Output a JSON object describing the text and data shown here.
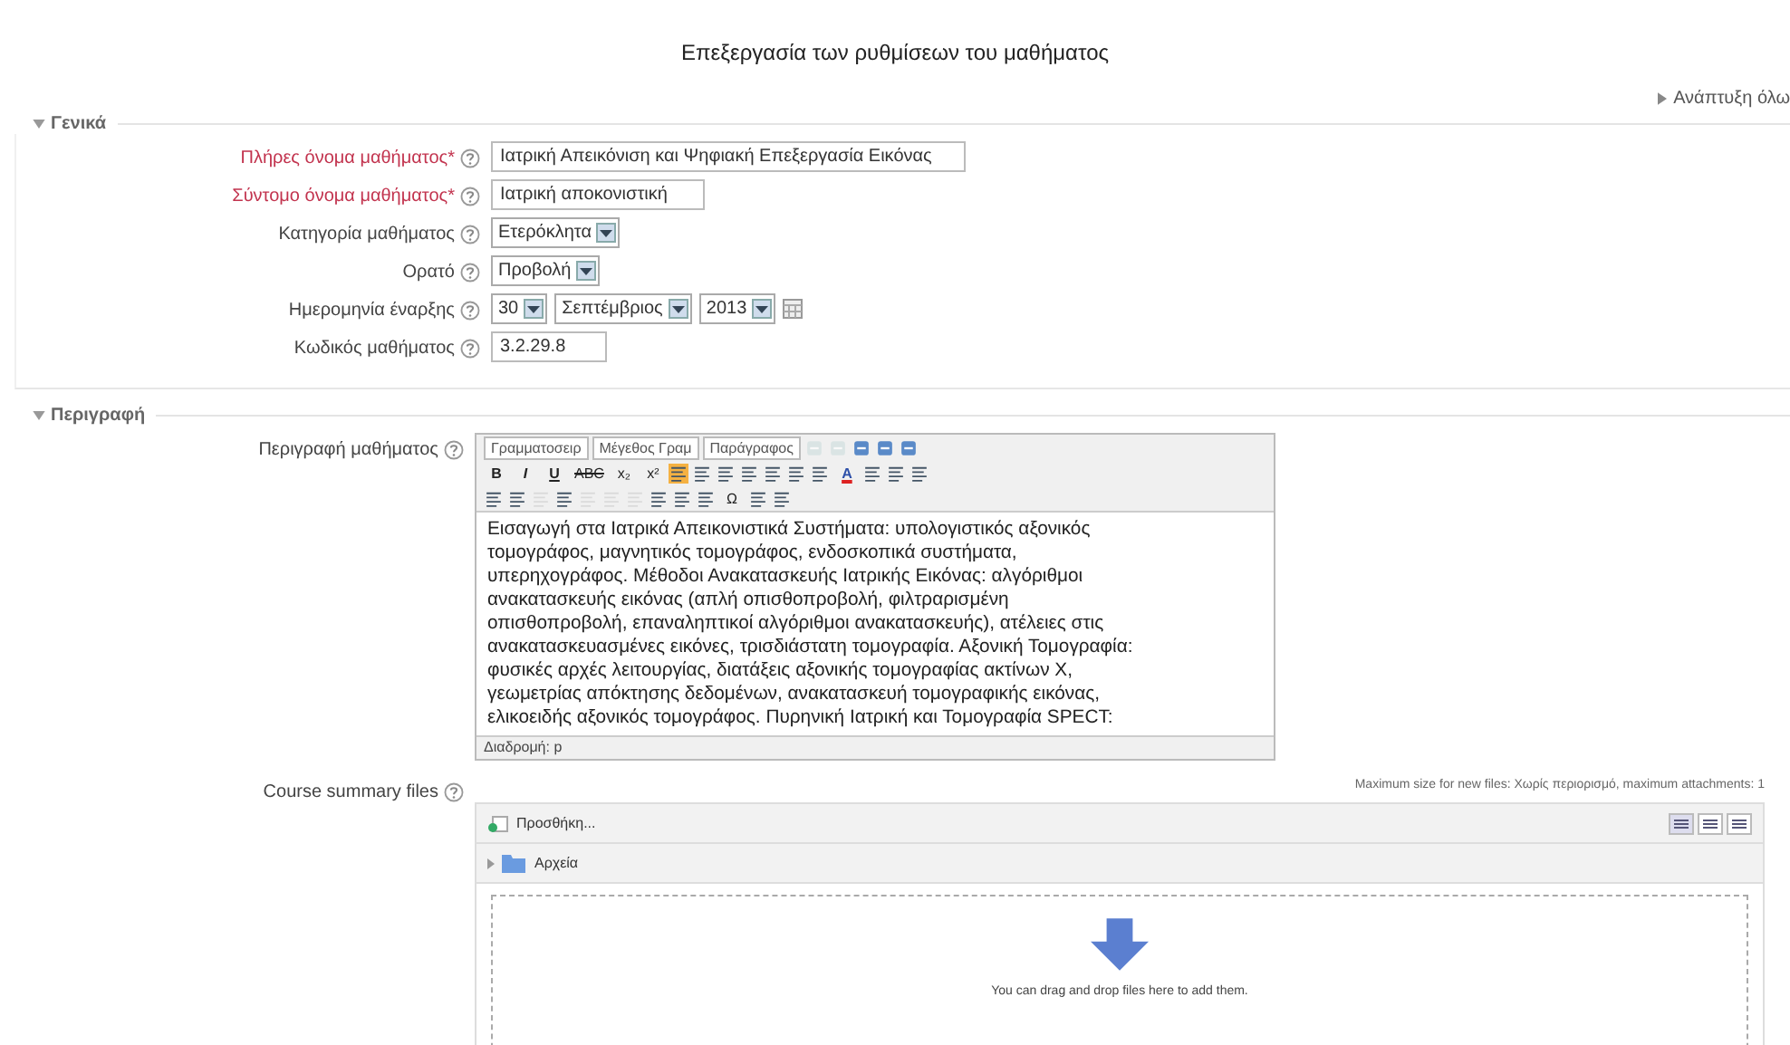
{
  "page_title": "Επεξεργασία των ρυθμίσεων του μαθήματος",
  "expand_all": {
    "label": "Ανάπτυξη όλω"
  },
  "sections": [
    {
      "legend": "Γενικά",
      "expanded": true,
      "fields": [
        {
          "label": "Πλήρες όνομα μαθήματος*",
          "required": true,
          "kind": "text",
          "value": "Ιατρική Απεικόνιση και Ψηφιακή Επεξεργασία Εικόνας"
        },
        {
          "label": "Σύντομο όνομα μαθήματος*",
          "required": true,
          "kind": "text",
          "value": "Ιατρική αποκονιστική"
        },
        {
          "label": "Κατηγορία μαθήματος",
          "required": false,
          "kind": "select",
          "value": "Ετερόκλητα"
        },
        {
          "label": "Ορατό",
          "required": false,
          "kind": "select",
          "value": "Προβολή"
        },
        {
          "label": "Ημερομηνία έναρξης",
          "required": false,
          "kind": "date",
          "parts": [
            "30",
            "Σεπτέμβριος",
            "2013"
          ]
        },
        {
          "label": "Κωδικός μαθήματος",
          "required": false,
          "kind": "text",
          "value": "3.2.29.8"
        }
      ]
    },
    {
      "legend": "Περιγραφή",
      "expanded": true,
      "fields": [
        {
          "label": "Περιγραφή μαθήματος",
          "required": false,
          "kind": "editor"
        },
        {
          "label": "Course summary files",
          "required": false,
          "kind": "files"
        }
      ]
    }
  ],
  "editor": {
    "dropdowns": [
      "Γραμματοσειρ",
      "Μέγεθος Γραμ",
      "Παράγραφος"
    ],
    "toolbar_rows": [
      [
        {
          "kind": "icon",
          "disabled": true
        },
        {
          "kind": "icon",
          "disabled": true
        },
        {
          "kind": "icon",
          "disabled": false
        },
        {
          "kind": "icon",
          "disabled": false
        },
        {
          "kind": "icon",
          "disabled": false
        }
      ],
      [
        {
          "kind": "text",
          "text": "B"
        },
        {
          "kind": "text",
          "text": "I"
        },
        {
          "kind": "text",
          "text": "U"
        },
        {
          "kind": "text",
          "text": "ABC"
        },
        {
          "kind": "text",
          "text": "x₂"
        },
        {
          "kind": "text",
          "text": "x²"
        },
        {
          "kind": "icon",
          "selected": true,
          "disabled": false
        },
        {
          "kind": "icon",
          "selected": false,
          "disabled": false
        },
        {
          "kind": "icon",
          "selected": false,
          "disabled": false
        },
        {
          "kind": "icon",
          "disabled": false
        },
        {
          "kind": "icon",
          "disabled": false
        },
        {
          "kind": "icon",
          "disabled": false
        },
        {
          "kind": "icon",
          "disabled": false
        },
        {
          "kind": "text",
          "text": "A"
        },
        {
          "kind": "icon",
          "disabled": false
        },
        {
          "kind": "icon",
          "disabled": false
        },
        {
          "kind": "icon",
          "disabled": false
        }
      ],
      [
        {
          "kind": "icon",
          "disabled": false
        },
        {
          "kind": "icon",
          "disabled": false
        },
        {
          "kind": "icon",
          "disabled": true
        },
        {
          "kind": "icon",
          "disabled": false
        },
        {
          "kind": "icon",
          "disabled": true
        },
        {
          "kind": "icon",
          "disabled": true
        },
        {
          "kind": "icon",
          "disabled": true
        },
        {
          "kind": "icon",
          "disabled": false
        },
        {
          "kind": "icon",
          "disabled": false
        },
        {
          "kind": "icon",
          "disabled": false
        },
        {
          "kind": "text",
          "text": "Ω"
        },
        {
          "kind": "icon",
          "disabled": false
        },
        {
          "kind": "icon",
          "disabled": false
        }
      ]
    ],
    "lines": [
      "Εισαγωγή στα Ιατρικά Απεικονιστικά Συστήματα: υπολογιστικός αξονικός",
      "τομογράφος, μαγνητικός τομογράφος, ενδοσκοπικά συστήματα,",
      "υπερηχογράφος. Μέθοδοι Ανακατασκευής Ιατρικής Εικόνας: αλγόριθμοι",
      "ανακατασκευής εικόνας (απλή οπισθοπροβολή, φιλτραρισμένη",
      "οπισθοπροβολή, επαναληπτικοί αλγόριθμοι ανακατασκευής), ατέλειες στις",
      "ανακατασκευασμένες εικόνες, τρισδιάστατη τομογραφία. Αξονική Τομογραφία:",
      "φυσικές αρχές λειτουργίας, διατάξεις αξονικής τομογραφίας ακτίνων Χ,",
      "γεωμετρίας απόκτησης δεδομένων, ανακατασκευή τομογραφικής εικόνας,",
      "ελικοειδής αξονικός τομογράφος. Πυρηνική Ιατρική και Τομογραφία SPECT:"
    ],
    "path": "Διαδρομή: p"
  },
  "files": {
    "limits": "Maximum size for new files: Χωρίς περιορισμό, maximum attachments: 1",
    "add_button": "Προσθήκη...",
    "views": [
      {
        "selected": true
      },
      {
        "selected": false
      },
      {
        "selected": false
      }
    ],
    "folder": "Αρχεία",
    "drop_hint": "You can drag and drop files here to add them."
  }
}
